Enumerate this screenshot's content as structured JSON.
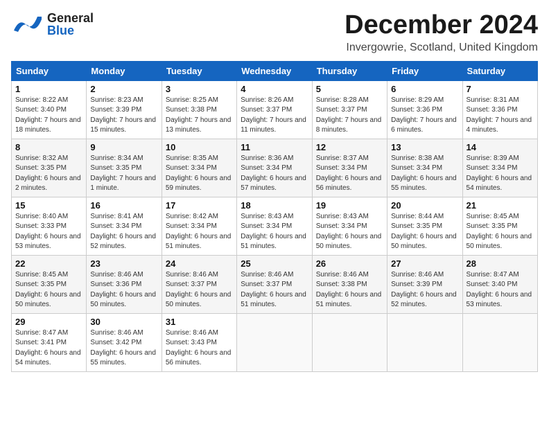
{
  "header": {
    "logo_general": "General",
    "logo_blue": "Blue",
    "title": "December 2024",
    "subtitle": "Invergowrie, Scotland, United Kingdom"
  },
  "weekdays": [
    "Sunday",
    "Monday",
    "Tuesday",
    "Wednesday",
    "Thursday",
    "Friday",
    "Saturday"
  ],
  "weeks": [
    [
      {
        "day": "1",
        "sunrise": "8:22 AM",
        "sunset": "3:40 PM",
        "daylight": "7 hours and 18 minutes."
      },
      {
        "day": "2",
        "sunrise": "8:23 AM",
        "sunset": "3:39 PM",
        "daylight": "7 hours and 15 minutes."
      },
      {
        "day": "3",
        "sunrise": "8:25 AM",
        "sunset": "3:38 PM",
        "daylight": "7 hours and 13 minutes."
      },
      {
        "day": "4",
        "sunrise": "8:26 AM",
        "sunset": "3:37 PM",
        "daylight": "7 hours and 11 minutes."
      },
      {
        "day": "5",
        "sunrise": "8:28 AM",
        "sunset": "3:37 PM",
        "daylight": "7 hours and 8 minutes."
      },
      {
        "day": "6",
        "sunrise": "8:29 AM",
        "sunset": "3:36 PM",
        "daylight": "7 hours and 6 minutes."
      },
      {
        "day": "7",
        "sunrise": "8:31 AM",
        "sunset": "3:36 PM",
        "daylight": "7 hours and 4 minutes."
      }
    ],
    [
      {
        "day": "8",
        "sunrise": "8:32 AM",
        "sunset": "3:35 PM",
        "daylight": "6 hours and 2 minutes."
      },
      {
        "day": "9",
        "sunrise": "8:34 AM",
        "sunset": "3:35 PM",
        "daylight": "7 hours and 1 minute."
      },
      {
        "day": "10",
        "sunrise": "8:35 AM",
        "sunset": "3:34 PM",
        "daylight": "6 hours and 59 minutes."
      },
      {
        "day": "11",
        "sunrise": "8:36 AM",
        "sunset": "3:34 PM",
        "daylight": "6 hours and 57 minutes."
      },
      {
        "day": "12",
        "sunrise": "8:37 AM",
        "sunset": "3:34 PM",
        "daylight": "6 hours and 56 minutes."
      },
      {
        "day": "13",
        "sunrise": "8:38 AM",
        "sunset": "3:34 PM",
        "daylight": "6 hours and 55 minutes."
      },
      {
        "day": "14",
        "sunrise": "8:39 AM",
        "sunset": "3:34 PM",
        "daylight": "6 hours and 54 minutes."
      }
    ],
    [
      {
        "day": "15",
        "sunrise": "8:40 AM",
        "sunset": "3:33 PM",
        "daylight": "6 hours and 53 minutes."
      },
      {
        "day": "16",
        "sunrise": "8:41 AM",
        "sunset": "3:34 PM",
        "daylight": "6 hours and 52 minutes."
      },
      {
        "day": "17",
        "sunrise": "8:42 AM",
        "sunset": "3:34 PM",
        "daylight": "6 hours and 51 minutes."
      },
      {
        "day": "18",
        "sunrise": "8:43 AM",
        "sunset": "3:34 PM",
        "daylight": "6 hours and 51 minutes."
      },
      {
        "day": "19",
        "sunrise": "8:43 AM",
        "sunset": "3:34 PM",
        "daylight": "6 hours and 50 minutes."
      },
      {
        "day": "20",
        "sunrise": "8:44 AM",
        "sunset": "3:35 PM",
        "daylight": "6 hours and 50 minutes."
      },
      {
        "day": "21",
        "sunrise": "8:45 AM",
        "sunset": "3:35 PM",
        "daylight": "6 hours and 50 minutes."
      }
    ],
    [
      {
        "day": "22",
        "sunrise": "8:45 AM",
        "sunset": "3:35 PM",
        "daylight": "6 hours and 50 minutes."
      },
      {
        "day": "23",
        "sunrise": "8:46 AM",
        "sunset": "3:36 PM",
        "daylight": "6 hours and 50 minutes."
      },
      {
        "day": "24",
        "sunrise": "8:46 AM",
        "sunset": "3:37 PM",
        "daylight": "6 hours and 50 minutes."
      },
      {
        "day": "25",
        "sunrise": "8:46 AM",
        "sunset": "3:37 PM",
        "daylight": "6 hours and 51 minutes."
      },
      {
        "day": "26",
        "sunrise": "8:46 AM",
        "sunset": "3:38 PM",
        "daylight": "6 hours and 51 minutes."
      },
      {
        "day": "27",
        "sunrise": "8:46 AM",
        "sunset": "3:39 PM",
        "daylight": "6 hours and 52 minutes."
      },
      {
        "day": "28",
        "sunrise": "8:47 AM",
        "sunset": "3:40 PM",
        "daylight": "6 hours and 53 minutes."
      }
    ],
    [
      {
        "day": "29",
        "sunrise": "8:47 AM",
        "sunset": "3:41 PM",
        "daylight": "6 hours and 54 minutes."
      },
      {
        "day": "30",
        "sunrise": "8:46 AM",
        "sunset": "3:42 PM",
        "daylight": "6 hours and 55 minutes."
      },
      {
        "day": "31",
        "sunrise": "8:46 AM",
        "sunset": "3:43 PM",
        "daylight": "6 hours and 56 minutes."
      },
      null,
      null,
      null,
      null
    ]
  ]
}
